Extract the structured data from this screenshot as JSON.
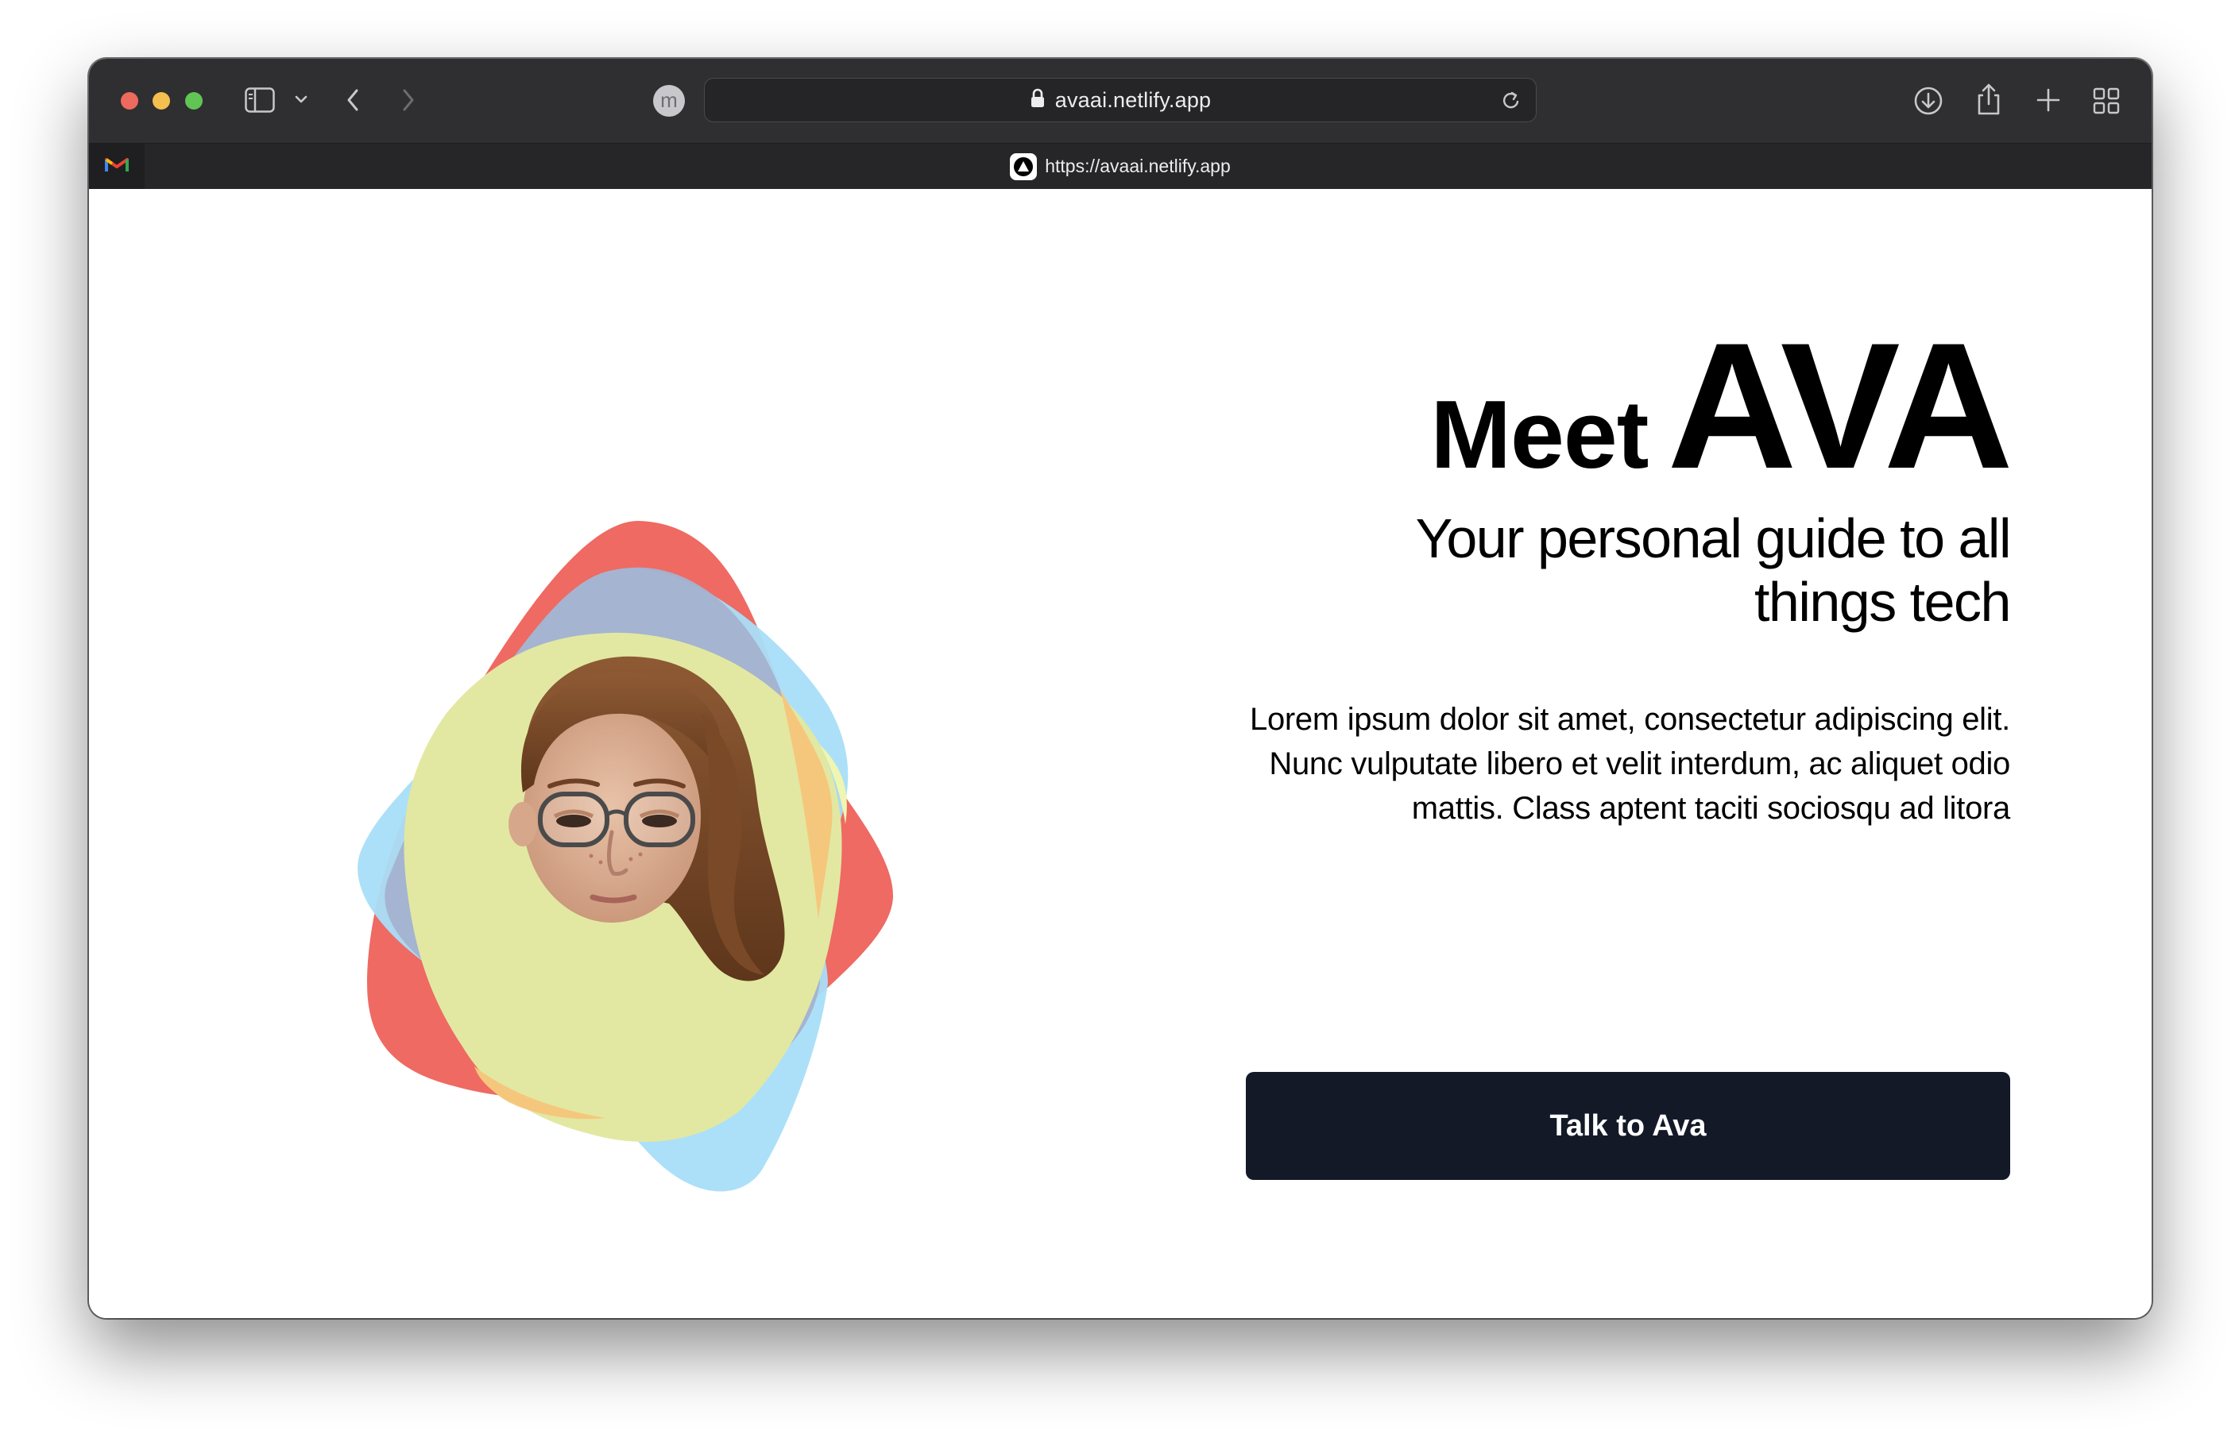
{
  "browser": {
    "address_url": "avaai.netlify.app",
    "tab_url": "https://avaai.netlify.app",
    "profile_initial": "m"
  },
  "hero": {
    "title_prefix": "Meet",
    "title_name": "AVA",
    "subtitle": "Your personal guide to all things tech",
    "body": "Lorem ipsum dolor sit amet, consectetur adipiscing elit. Nunc vulputate libero et velit interdum, ac aliquet odio mattis. Class aptent taciti sociosqu ad litora",
    "cta_label": "Talk to Ava"
  },
  "colors": {
    "blob_red": "#ee6a62",
    "blob_blue": "#a8def8",
    "blob_green": "#e2e8a2",
    "button_bg": "#131927"
  },
  "icons": [
    "sidebar-icon",
    "chevron-down-icon",
    "back-icon",
    "forward-icon",
    "lock-icon",
    "reload-icon",
    "download-icon",
    "share-icon",
    "new-tab-icon",
    "tab-overview-icon",
    "gmail-icon",
    "site-favicon",
    "avatar-memoji"
  ]
}
